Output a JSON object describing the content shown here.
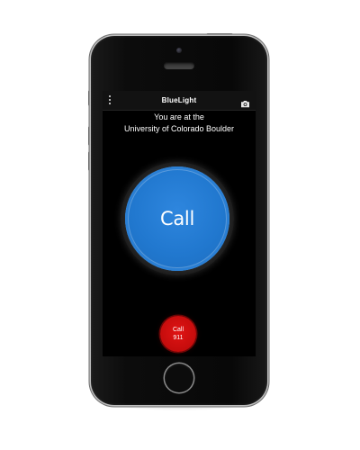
{
  "app": {
    "title": "BlueLight"
  },
  "location": {
    "line1": "You are at the",
    "line2": "University of Colorado Boulder"
  },
  "main_button": {
    "label": "Call",
    "color": "#2178cf"
  },
  "emergency_button": {
    "line1": "Call",
    "line2": "911",
    "color": "#c40c0c"
  },
  "icons": {
    "menu": "more-vertical-icon",
    "camera": "camera-icon"
  }
}
